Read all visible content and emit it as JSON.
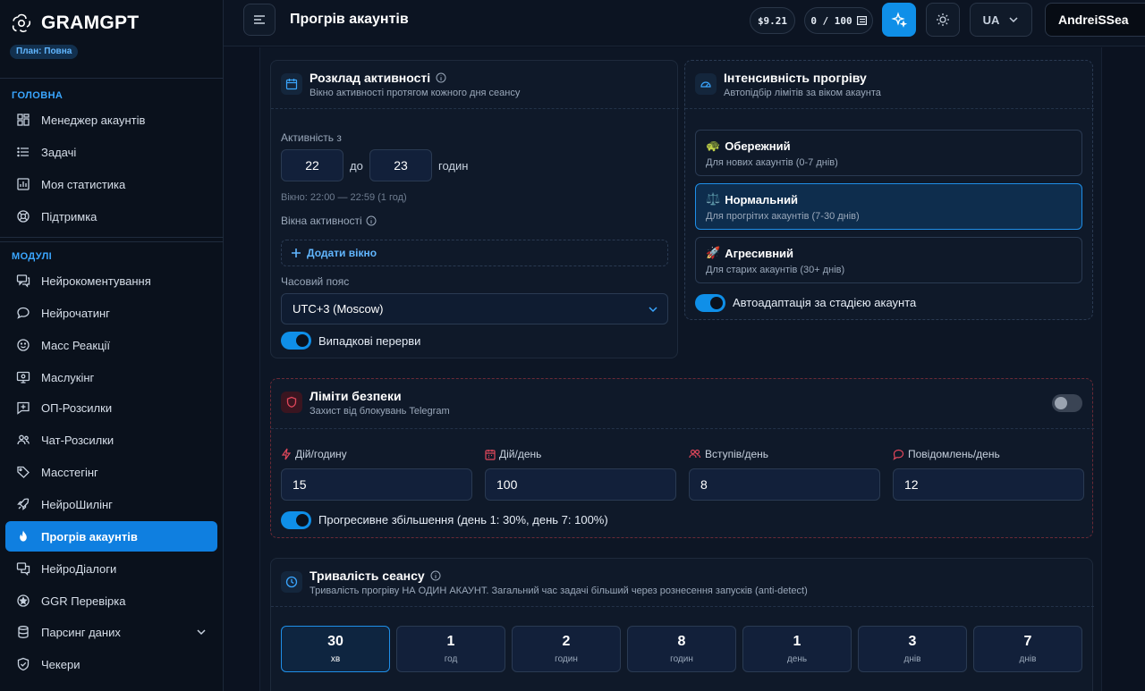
{
  "brand": {
    "name": "GRAMGPT",
    "plan": "План: Повна"
  },
  "sidebar": {
    "section_main": "ГОЛОВНА",
    "main_items": [
      {
        "label": "Менеджер акаунтів",
        "icon": "grid-icon"
      },
      {
        "label": "Задачі",
        "icon": "list-icon"
      },
      {
        "label": "Моя статистика",
        "icon": "chart-icon"
      },
      {
        "label": "Підтримка",
        "icon": "lifebuoy-icon"
      }
    ],
    "section_modules": "МОДУЛІ",
    "module_items": [
      {
        "label": "Нейрокоментування",
        "icon": "comments-icon"
      },
      {
        "label": "Нейрочатинг",
        "icon": "chat-bubble-icon"
      },
      {
        "label": "Масс Реакції",
        "icon": "smile-icon"
      },
      {
        "label": "Маслукінг",
        "icon": "monitor-icon"
      },
      {
        "label": "ОП-Розсилки",
        "icon": "message-plus-icon"
      },
      {
        "label": "Чат-Розсилки",
        "icon": "users-icon"
      },
      {
        "label": "Масстегінг",
        "icon": "tag-icon"
      },
      {
        "label": "НейроШилінг",
        "icon": "rocket-icon"
      },
      {
        "label": "Прогрів акаунтів",
        "icon": "flame-icon",
        "active": true
      },
      {
        "label": "НейроДіалоги",
        "icon": "dialogs-icon"
      },
      {
        "label": "GGR Перевірка",
        "icon": "star-badge-icon"
      },
      {
        "label": "Парсинг даних",
        "icon": "database-icon",
        "has_chevron": true
      },
      {
        "label": "Чекери",
        "icon": "shield-check-icon"
      }
    ]
  },
  "topbar": {
    "title": "Прогрів акаунтів",
    "balance": "$9.21",
    "quota": "0 / 100",
    "lang": "UA",
    "user": "AndreiSSea"
  },
  "schedule": {
    "title": "Розклад активності",
    "subtitle": "Вікно активності протягом кожного дня сеансу",
    "activity_from_label": "Активність з",
    "from": "22",
    "to_label": "до",
    "to": "23",
    "hours_label": "годин",
    "window_hint": "Вікно: 22:00 — 22:59 (1 год)",
    "windows_label": "Вікна активності",
    "add_window": "Додати вікно",
    "timezone_label": "Часовий пояс",
    "timezone": "UTC+3 (Moscow)",
    "random_breaks": "Випадкові перерви"
  },
  "intensity": {
    "title": "Інтенсивність прогріву",
    "subtitle": "Автопідбір лімітів за віком акаунта",
    "options": [
      {
        "emoji": "🐢",
        "title": "Обережний",
        "desc": "Для нових акаунтів (0-7 днів)"
      },
      {
        "emoji": "⚖️",
        "title": "Нормальний",
        "desc": "Для прогрітих акаунтів (7-30 днів)",
        "selected": true
      },
      {
        "emoji": "🚀",
        "title": "Агресивний",
        "desc": "Для старих акаунтів (30+ днів)"
      }
    ],
    "auto_adapt": "Автоадаптація за стадією акаунта"
  },
  "limits": {
    "title": "Ліміти безпеки",
    "subtitle": "Захист від блокувань Telegram",
    "fields": [
      {
        "label": "Дій/годину",
        "value": "15",
        "icon": "lightning-icon"
      },
      {
        "label": "Дій/день",
        "value": "100",
        "icon": "calendar-icon"
      },
      {
        "label": "Вступів/день",
        "value": "8",
        "icon": "users-icon"
      },
      {
        "label": "Повідомлень/день",
        "value": "12",
        "icon": "chat-bubble-icon"
      }
    ],
    "progressive": "Прогресивне збільшення (день 1: 30%, день 7: 100%)"
  },
  "duration": {
    "title": "Тривалість сеансу",
    "subtitle": "Тривалість прогріву НА ОДИН АКАУНТ. Загальний час задачі більший через рознесення запусків (anti-detect)",
    "options": [
      {
        "n": "30",
        "u": "хв",
        "selected": true
      },
      {
        "n": "1",
        "u": "год"
      },
      {
        "n": "2",
        "u": "годин"
      },
      {
        "n": "8",
        "u": "годин"
      },
      {
        "n": "1",
        "u": "день"
      },
      {
        "n": "3",
        "u": "днів"
      },
      {
        "n": "7",
        "u": "днів"
      }
    ]
  },
  "colors": {
    "accent": "#0f7fe0",
    "bg": "#0b1220",
    "danger": "#e0475b"
  }
}
